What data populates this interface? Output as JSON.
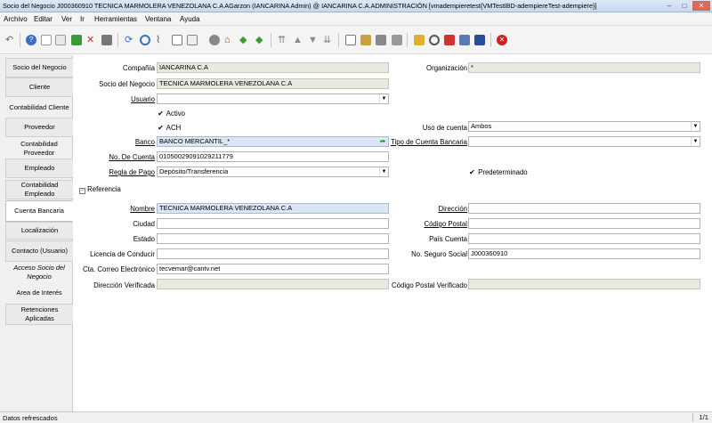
{
  "window": {
    "title": "Socio del Negocio  J000360910  TECNICA MARMOLERA VENEZOLANA C.A  AGarzon (IANCARINA Admin) @ IANCARINA C.A.ADMINISTRACIÓN [vmadempieretest{VMTestIBD-adempiereTest-adempiere}]",
    "minimize": "–",
    "maximize": "□",
    "close": "✕"
  },
  "menu": [
    "Archivo",
    "Editar",
    "Ver",
    "Ir",
    "Herramientas",
    "Ventana",
    "Ayuda"
  ],
  "toolbar_icons": [
    "undo-icon",
    "help-icon",
    "new-record-icon",
    "copy-record-icon",
    "save-icon",
    "delete-icon",
    "delete-selection-icon",
    "refresh-icon",
    "find-icon",
    "attachment-icon",
    "chat-icon",
    "multi-record-icon",
    "history-icon",
    "home-icon",
    "parent-record-icon",
    "detail-record-icon",
    "first-record-icon",
    "previous-record-icon",
    "next-record-icon",
    "last-record-icon",
    "report-icon",
    "archive-icon",
    "print-icon",
    "print-preview-icon",
    "lock-icon",
    "zoom-across-icon",
    "active-workflows-icon",
    "request-icon",
    "product-info-icon",
    "exit-icon"
  ],
  "tabs": [
    {
      "label": "Socio del Negocio"
    },
    {
      "label": "Cliente"
    },
    {
      "label": "Contabilidad Cliente"
    },
    {
      "label": "Proveedor"
    },
    {
      "label": "Contabilidad Proveedor"
    },
    {
      "label": "Empleado"
    },
    {
      "label": "Contabilidad Empleado"
    },
    {
      "label": "Cuenta Bancaria"
    },
    {
      "label": "Localización"
    },
    {
      "label": "Contacto (Usuario)"
    },
    {
      "label": "Acceso Socio del Negocio"
    },
    {
      "label": "Area de Interés"
    },
    {
      "label": "Retenciones Aplicadas"
    }
  ],
  "form": {
    "compania_label": "Compañía",
    "compania_value": "IANCARINA C.A",
    "organizacion_label": "Organización",
    "organizacion_value": "*",
    "socio_label": "Socio del Negocio",
    "socio_value": "TECNICA MARMOLERA VENEZOLANA C.A",
    "usuario_label": "Usuario",
    "usuario_value": "",
    "activo_label": "Activo",
    "ach_label": "ACH",
    "uso_cuenta_label": "Uso de cuenta",
    "uso_cuenta_value": "Ambos",
    "banco_label": "Banco",
    "banco_value": "BANCO MERCANTIL_*",
    "tipo_cuenta_label": "Tipo de Cuenta Bancaria",
    "tipo_cuenta_value": "",
    "no_cuenta_label": "No. De Cuenta",
    "no_cuenta_value": "01050029091029211779",
    "regla_pago_label": "Regla de Pago",
    "regla_pago_value": "Depósito/Transferencia",
    "predeterminado_label": "Predeterminado",
    "referencia_label": "Referencia",
    "nombre_label": "Nombre",
    "nombre_value": "TECNICA MARMOLERA VENEZOLANA C.A",
    "direccion_label": "Dirección",
    "direccion_value": "",
    "ciudad_label": "Ciudad",
    "ciudad_value": "",
    "codigo_postal_label": "Código Postal",
    "codigo_postal_value": "",
    "estado_label": "Estado",
    "estado_value": "",
    "pais_cuenta_label": "País Cuenta",
    "pais_cuenta_value": "",
    "licencia_label": "Licencia de Conducir",
    "licencia_value": "",
    "seguro_social_label": "No. Seguro Social",
    "seguro_social_value": "J000360910",
    "correo_label": "Cta. Correo Electrónico",
    "correo_value": "tecvemar@cantv.net",
    "dir_verificada_label": "Dirección Verificada",
    "dir_verificada_value": "",
    "cp_verificado_label": "Código Postal Verificado",
    "cp_verificado_value": ""
  },
  "status": {
    "message": "Datos refrescados",
    "page": "1/1"
  }
}
